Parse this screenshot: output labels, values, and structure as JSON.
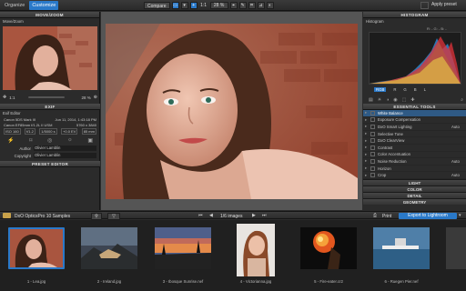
{
  "topbar": {
    "tabs": [
      "Organize",
      "Customize"
    ],
    "compare_label": "Compare",
    "zoom_fit": "1:1",
    "zoom_value": "28 %",
    "apply_preset": "Apply preset"
  },
  "left": {
    "move_zoom_title": "MOVE/ZOOM",
    "move_zoom_sub": "Move/Zoom",
    "zoom_ratio": "1:1",
    "zoom_pct": "28 %",
    "exif_title": "EXIF",
    "exif_sub": "Exif Editor",
    "camera": "Canon 5DS Mark III",
    "datetime": "Jun 11, 2014, 1:43:18 PM",
    "lens": "Canon EF85mm f/1.2L II USM",
    "resolution": "5760 x 3840",
    "iso": "ISO 160",
    "aperture": "f/1.2",
    "shutter": "1/5000 s",
    "ev": "+0.0 EV",
    "focal": "85 mm",
    "author_label": "Author",
    "author": "Olivier Lamblin",
    "copyright_label": "Copyright",
    "copyright": "Olivier Lamblin",
    "preset_title": "PRESET EDITOR"
  },
  "right": {
    "histogram_title": "HISTOGRAM",
    "histogram_sub": "Histogram",
    "rgb_readout": "R: - G: - B: -",
    "channels": [
      "RGB",
      "R",
      "G",
      "B",
      "L"
    ],
    "essential_title": "ESSENTIAL TOOLS",
    "tools": [
      {
        "name": "White Balance",
        "value": "",
        "hl": true
      },
      {
        "name": "Exposure Compensation",
        "value": "",
        "hl": false
      },
      {
        "name": "DxO Smart Lighting",
        "value": "Auto",
        "hl": false
      },
      {
        "name": "Selective Tone",
        "value": "",
        "hl": false
      },
      {
        "name": "DxO ClearView",
        "value": "",
        "hl": false
      },
      {
        "name": "Contrast",
        "value": "",
        "hl": false
      },
      {
        "name": "Color Accentuation",
        "value": "",
        "hl": false
      },
      {
        "name": "Noise Reduction",
        "value": "Auto",
        "hl": false
      },
      {
        "name": "Horizon",
        "value": "",
        "hl": false
      },
      {
        "name": "Crop",
        "value": "Auto",
        "hl": false
      }
    ],
    "sections": [
      "LIGHT",
      "COLOR",
      "DETAIL",
      "GEOMETRY"
    ]
  },
  "browser": {
    "folder": "DxO OpticsPro 10 Samples",
    "count": "1/6 images",
    "print": "Print",
    "export": "Export to Lightroom"
  },
  "filmstrip": [
    {
      "caption": "1 - Lea.jpg"
    },
    {
      "caption": "2 - Ireland.jpg"
    },
    {
      "caption": "3 - Ibosque Sunrise.nef"
    },
    {
      "caption": "4 - Victorianna.jpg"
    },
    {
      "caption": "5 - Fire-eater.cr2"
    },
    {
      "caption": "6 - Ruegen Pier.nef"
    }
  ],
  "colors": {
    "accent": "#2a79c9",
    "panel": "#2b2b2b",
    "highlight": "#2f5a85"
  }
}
